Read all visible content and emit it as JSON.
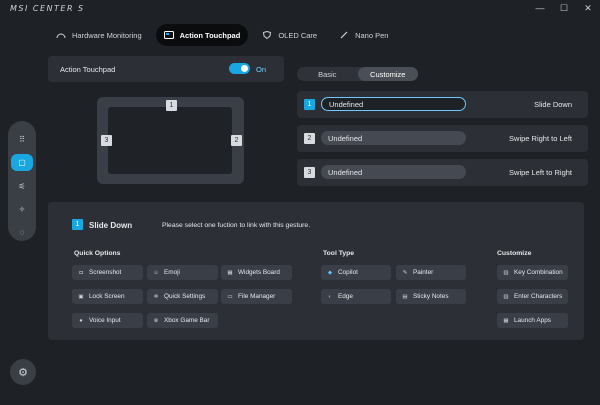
{
  "app": {
    "logo": "MSI CENTER S"
  },
  "window": {
    "minimize": "—",
    "maximize": "☐",
    "close": "✕"
  },
  "tabs": [
    {
      "label": "Hardware Monitoring",
      "icon": "gauge-icon"
    },
    {
      "label": "Action Touchpad",
      "icon": "touchpad-icon",
      "active": true
    },
    {
      "label": "OLED Care",
      "icon": "shield-icon"
    },
    {
      "label": "Nano Pen",
      "icon": "pen-icon"
    }
  ],
  "sidebar": {
    "items": [
      "apps-grid-icon",
      "touchpad-icon",
      "sliders-icon",
      "sparkle-icon",
      "feedback-icon"
    ]
  },
  "toggle": {
    "label": "Action Touchpad",
    "state": "On"
  },
  "touchpad": {
    "zones": [
      "1",
      "2",
      "3"
    ]
  },
  "mode_tabs": {
    "basic": "Basic",
    "customize": "Customize"
  },
  "gestures": [
    {
      "num": "1",
      "value": "Undefined",
      "label": "Slide Down"
    },
    {
      "num": "2",
      "value": "Undefined",
      "label": "Swipe Right to Left"
    },
    {
      "num": "3",
      "value": "Undefined",
      "label": "Swipe Left to Right"
    }
  ],
  "detail": {
    "num": "1",
    "title": "Slide Down",
    "hint": "Please select one fuction to link with this gesture.",
    "quick_options": {
      "heading": "Quick Options",
      "items": [
        "Screenshot",
        "Emoji",
        "Widgets Board",
        "Lock Screen",
        "Quick Settings",
        "File Manager",
        "Voice Input",
        "Xbox Game Bar"
      ]
    },
    "tool_type": {
      "heading": "Tool Type",
      "items": [
        "Copilot",
        "Painter",
        "Edge",
        "Sticky Notes"
      ]
    },
    "customize": {
      "heading": "Customize",
      "items": [
        "Key Combination",
        "Enter Characters",
        "Launch Apps"
      ]
    }
  }
}
